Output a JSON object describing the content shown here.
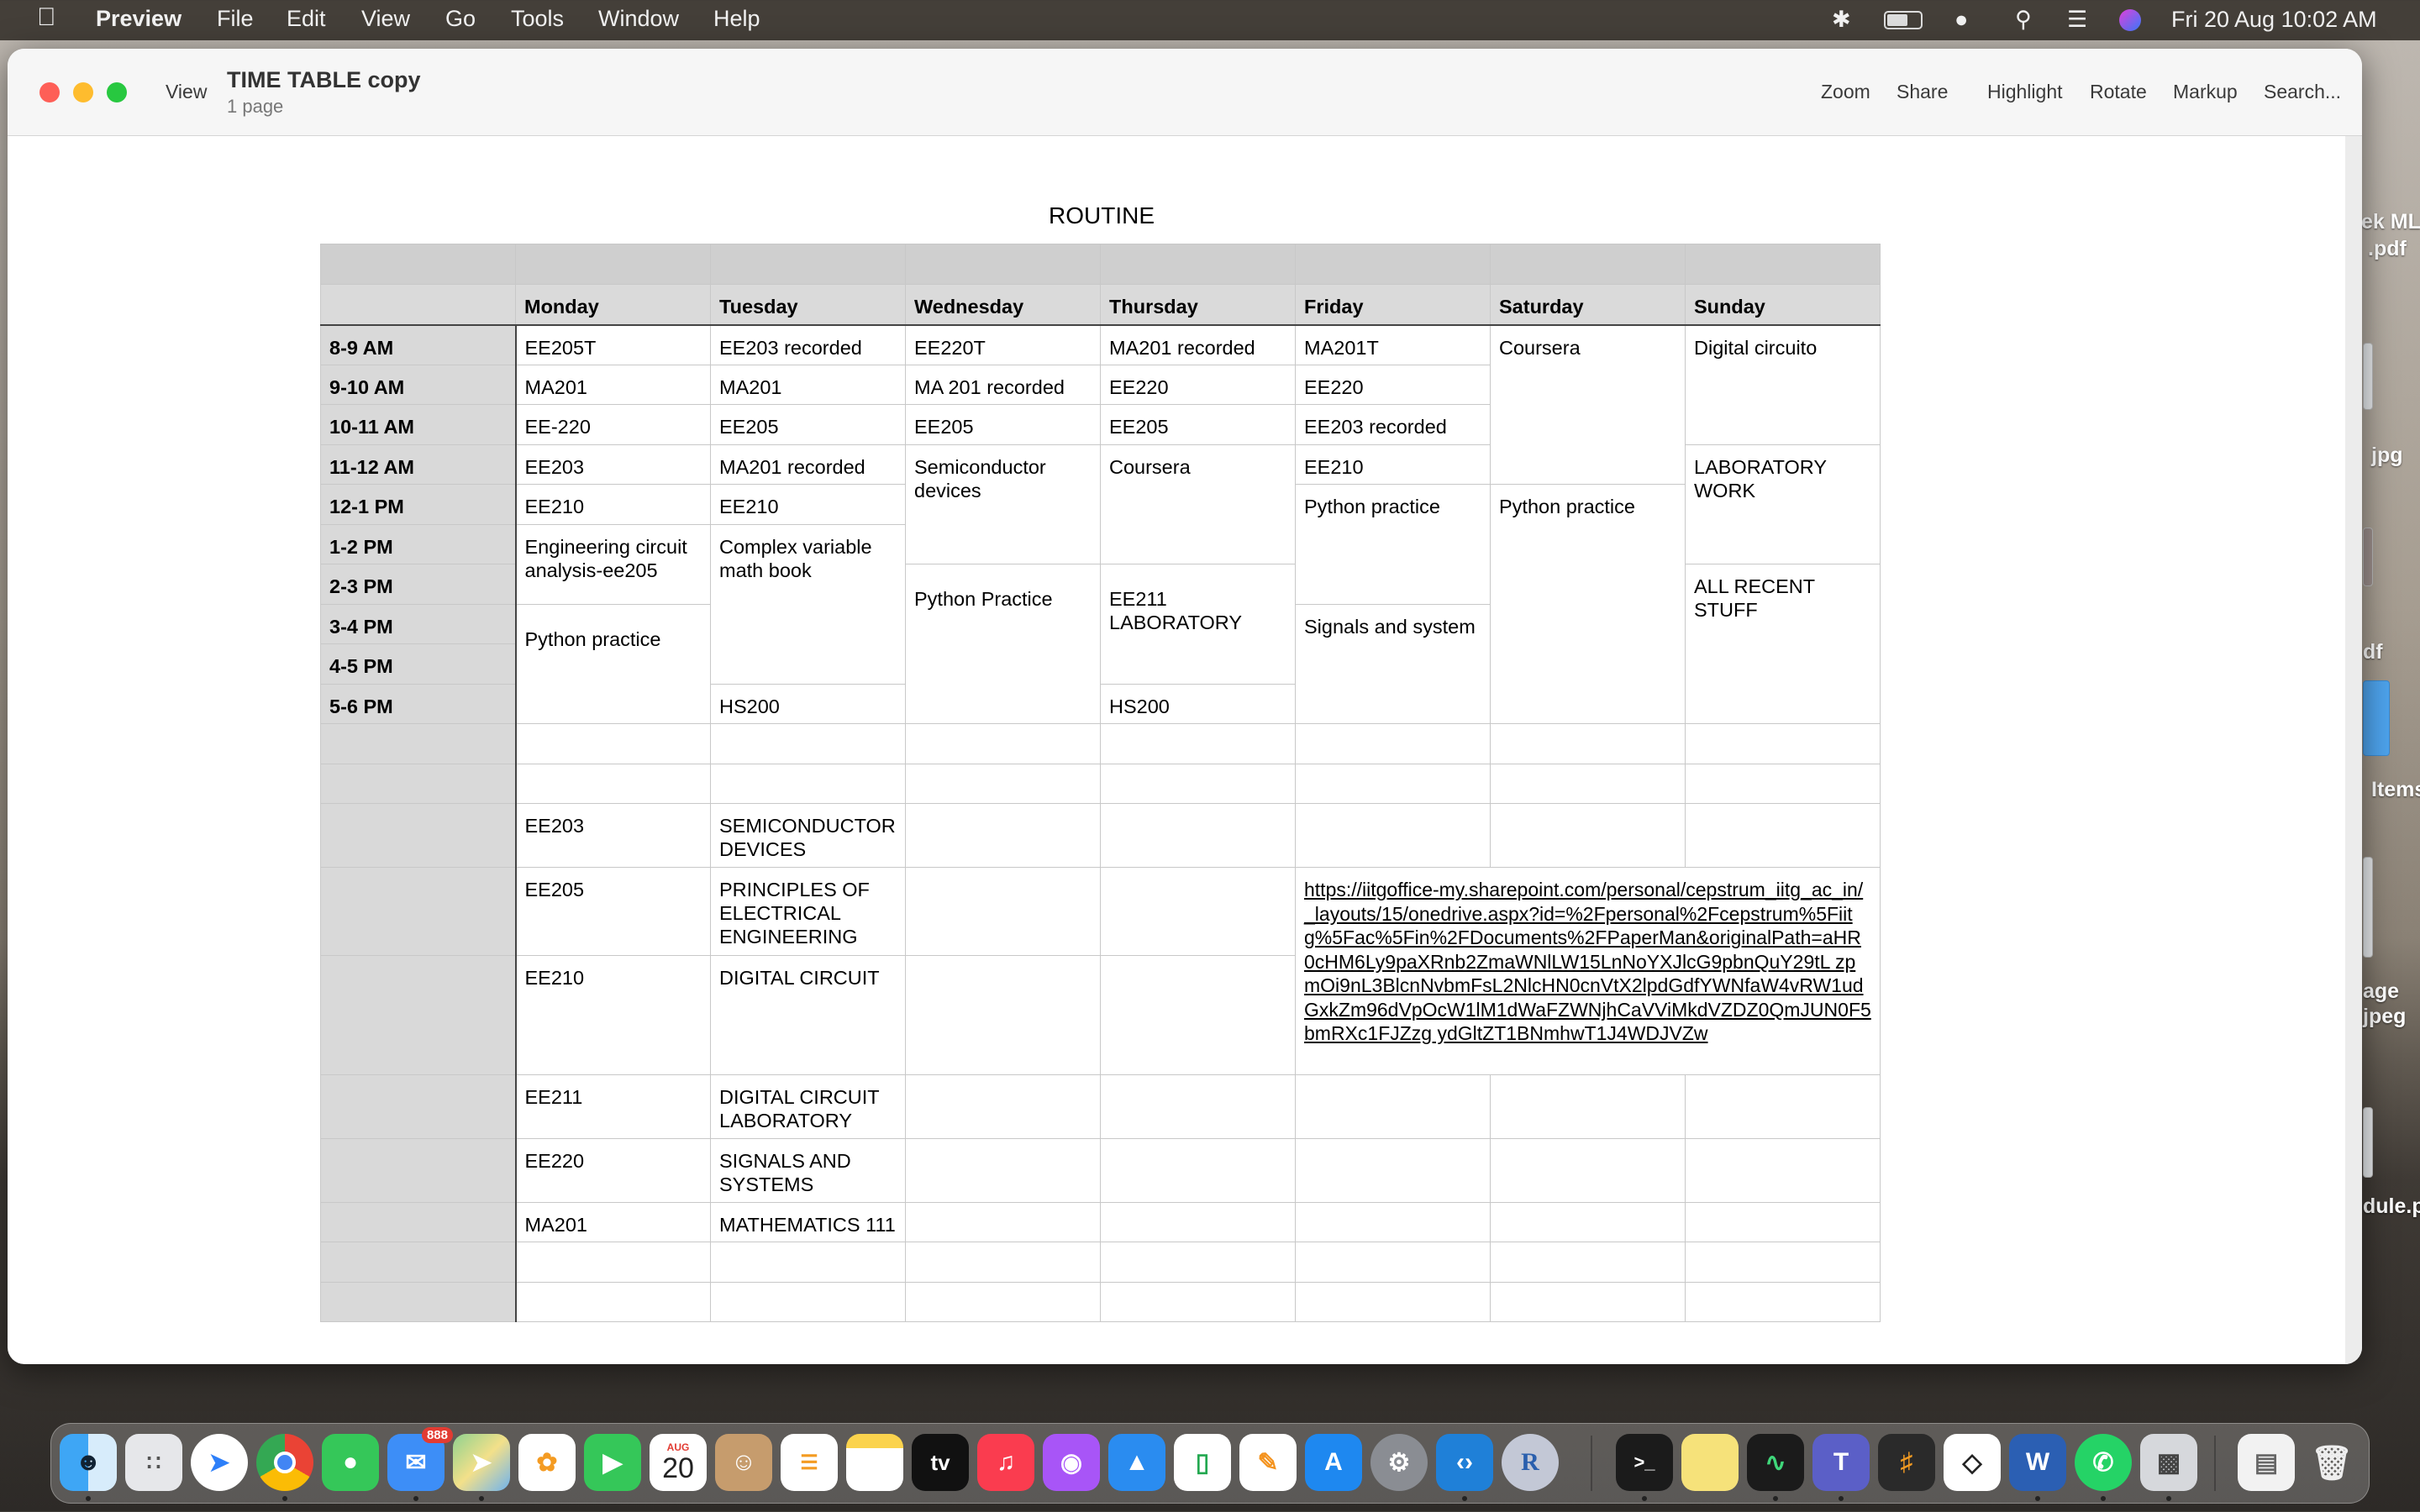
{
  "menubar": {
    "app": "Preview",
    "items": [
      "File",
      "Edit",
      "View",
      "Go",
      "Tools",
      "Window",
      "Help"
    ],
    "datetime": "Fri 20 Aug  10:02 AM"
  },
  "window": {
    "title": "TIME TABLE copy",
    "subtitle": "1 page",
    "view_label": "View",
    "toolbar": {
      "zoom": "Zoom",
      "share": "Share",
      "highlight": "Highlight",
      "rotate": "Rotate",
      "markup": "Markup",
      "search": "Search..."
    }
  },
  "document": {
    "heading": "ROUTINE",
    "days": [
      "Monday",
      "Tuesday",
      "Wednesday",
      "Thursday",
      "Friday",
      "Saturday",
      "Sunday"
    ],
    "times": [
      "8-9 AM",
      "9-10 AM",
      "10-11 AM",
      "11-12 AM",
      "12-1 PM",
      "1-2 PM",
      "2-3 PM",
      "3-4 PM",
      "4-5 PM",
      "5-6 PM"
    ],
    "slots": {
      "mon": [
        "EE205T",
        "MA201",
        "EE-220",
        "EE203",
        "EE210",
        "Engineering circuit analysis-ee205",
        "Python practice"
      ],
      "tue": [
        "EE203 recorded",
        "MA201",
        "EE205",
        "MA201 recorded",
        "EE210",
        "Complex variable math book",
        "HS200"
      ],
      "wed": [
        "EE220T",
        "MA 201 recorded",
        "EE205",
        "Semiconductor devices",
        "Python Practice"
      ],
      "thu": [
        "MA201 recorded",
        "EE220",
        "EE205",
        "Coursera",
        "EE211 LABORATORY",
        "HS200"
      ],
      "fri": [
        "MA201T",
        "EE220",
        "EE203 recorded",
        "EE210",
        "Python practice",
        "Signals and system"
      ],
      "sat": [
        "Coursera",
        "Python practice"
      ],
      "sun": [
        "Digital circuito",
        "LABORATORY WORK",
        "ALL RECENT STUFF"
      ]
    },
    "courses": [
      {
        "code": "EE203",
        "name": "SEMICONDUCTOR DEVICES"
      },
      {
        "code": "EE205",
        "name": "PRINCIPLES OF ELECTRICAL ENGINEERING"
      },
      {
        "code": "EE210",
        "name": "DIGITAL CIRCUIT"
      },
      {
        "code": "EE211",
        "name": "DIGITAL CIRCUIT LABORATORY"
      },
      {
        "code": "EE220",
        "name": "SIGNALS AND SYSTEMS"
      },
      {
        "code": "MA201",
        "name": "MATHEMATICS 111"
      }
    ],
    "link": "https://iitgoffice-my.sharepoint.com/personal/cepstrum_iitg_ac_in/_layouts/15/onedrive.aspx?id=%2Fpersonal%2Fcepstrum%5Fiitg%5Fac%5Fin%2FDocuments%2FPaperMan&originalPath=aHR0cHM6Ly9paXRnb2ZmaWNlLW15LnNoYXJlcG9pbnQuY29tL zpmOi9nL3BlcnNvbmFsL2NlcHN0cnVtX2lpdGdfYWNfaW4vRW1udGxkZm96dVpOcW1lM1dWaFZWNjhCaVViMkdVZDZ0QmJUN0F5bmRXc1FJZzg ydGltZT1BNmhwT1J4WDJVZw"
  },
  "desktop": {
    "items": [
      "ek ML",
      ".pdf",
      "jpg",
      "df",
      "Items",
      "age",
      "jpeg",
      "dule.p"
    ]
  },
  "dock": {
    "mail_badge": "888",
    "calendar_month": "AUG",
    "calendar_day": "20",
    "tv_label": "tv",
    "r_label": "R",
    "word_label": "W"
  },
  "colors": {
    "menubar": "#3a342f",
    "window": "#ffffff",
    "header_fill": "#d9d9d9",
    "close": "#fe5f57",
    "minimize": "#febc2e",
    "zoom": "#28c840"
  }
}
